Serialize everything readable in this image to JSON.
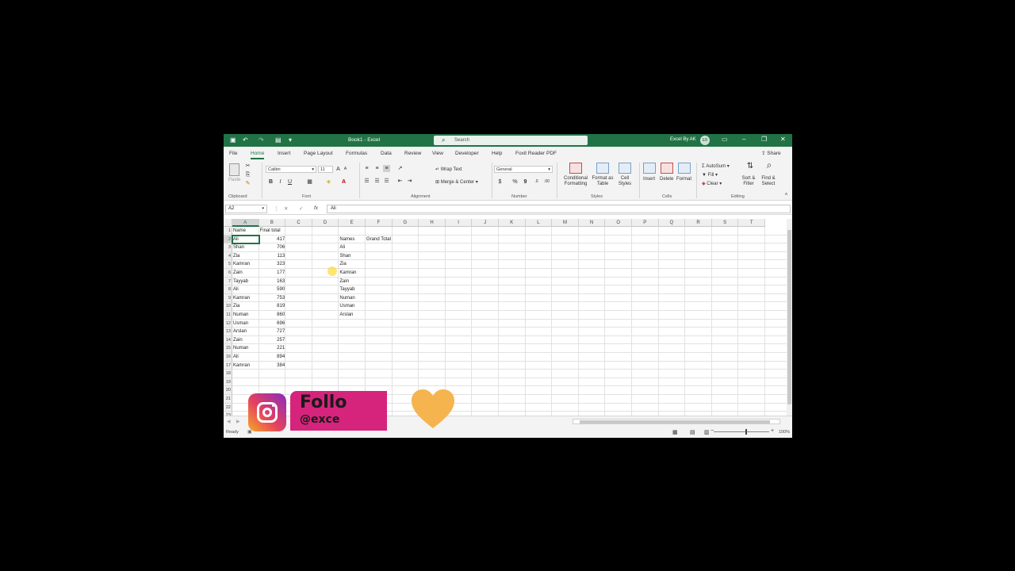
{
  "titlebar": {
    "doc_title": "Book1 - Excel",
    "search_placeholder": "Search",
    "user_name": "Excel By AK",
    "avatar_initials": "EB"
  },
  "tabs": [
    "File",
    "Home",
    "Insert",
    "Page Layout",
    "Formulas",
    "Data",
    "Review",
    "View",
    "Developer",
    "Help",
    "Foxit Reader PDF"
  ],
  "active_tab": "Home",
  "share_label": "Share",
  "ribbon": {
    "clipboard": {
      "paste": "Paste",
      "label": "Clipboard"
    },
    "font": {
      "name": "Calibri",
      "size": "11",
      "bold": "B",
      "italic": "I",
      "underline": "U",
      "label": "Font"
    },
    "alignment": {
      "wrap_text": "Wrap Text",
      "merge_center": "Merge & Center",
      "label": "Alignment"
    },
    "number": {
      "format": "General",
      "currency": "$",
      "percent": "%",
      "comma": "9",
      "label": "Number"
    },
    "styles": {
      "conditional": "Conditional Formatting",
      "format_table": "Format as Table",
      "cell_styles": "Cell Styles",
      "label": "Styles"
    },
    "cells": {
      "insert": "Insert",
      "delete": "Delete",
      "format": "Format",
      "label": "Cells"
    },
    "editing": {
      "autosum": "AutoSum",
      "fill": "Fill",
      "clear": "Clear",
      "sort_filter": "Sort & Filter",
      "find_select": "Find & Select",
      "label": "Editing"
    }
  },
  "formula_bar": {
    "name_box": "A2",
    "fx": "fx",
    "content": "Ali"
  },
  "columns": [
    "A",
    "B",
    "C",
    "D",
    "E",
    "F",
    "G",
    "H",
    "I",
    "J",
    "K",
    "L",
    "M",
    "N",
    "O",
    "P",
    "Q",
    "R",
    "S",
    "T"
  ],
  "rows": [
    "1",
    "2",
    "3",
    "4",
    "5",
    "6",
    "7",
    "8",
    "9",
    "10",
    "11",
    "12",
    "13",
    "14",
    "15",
    "16",
    "17",
    "18",
    "19",
    "20",
    "21",
    "22",
    "23"
  ],
  "table": {
    "header_a": "Name",
    "header_b": "Final total",
    "names": [
      "Ali",
      "Shan",
      "Zia",
      "Kamran",
      "Zain",
      "Tayyab",
      "Ali",
      "Kamran",
      "Zia",
      "Numan",
      "Usman",
      "Arslan",
      "Zain",
      "Numan",
      "Ali",
      "Kamran"
    ],
    "values": [
      "417",
      "706",
      "113",
      "323",
      "177",
      "163",
      "590",
      "753",
      "819",
      "860",
      "696",
      "727",
      "257",
      "221",
      "894",
      "384"
    ]
  },
  "summary": {
    "header_e": "Names",
    "header_f": "Grand Total",
    "names": [
      "Ali",
      "Shan",
      "Zia",
      "Kamran",
      "Zain",
      "Tayyab",
      "Numan",
      "Usman",
      "Arslan"
    ]
  },
  "status": {
    "ready": "Ready",
    "zoom": "100%"
  },
  "overlay": {
    "follow": "Follo",
    "handle": "@exce"
  },
  "colors": {
    "excel_green": "#217346",
    "banner_pink": "#d6247c",
    "heart": "#f6b44f"
  }
}
